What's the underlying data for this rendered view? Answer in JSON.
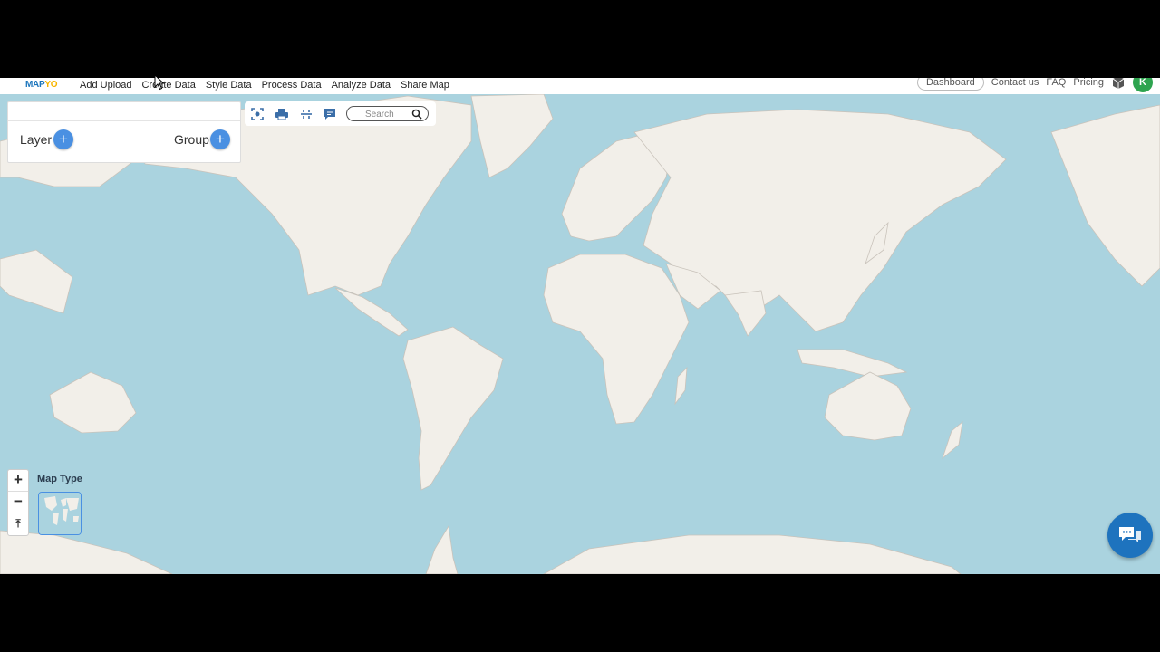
{
  "app": {
    "logo": {
      "text": "MAP",
      "accent": "YO"
    },
    "nav": [
      {
        "label": "Add Upload"
      },
      {
        "label": "Create Data"
      },
      {
        "label": "Style Data"
      },
      {
        "label": "Process Data"
      },
      {
        "label": "Analyze Data"
      },
      {
        "label": "Share Map"
      }
    ],
    "nav_right": {
      "dashboard": "Dashboard",
      "contact": "Contact us",
      "faq": "FAQ",
      "pricing": "Pricing",
      "avatar_initial": "K"
    }
  },
  "layer_panel": {
    "layer_label": "Layer",
    "group_label": "Group",
    "add_symbol": "+"
  },
  "toolbar": {
    "search_placeholder": "Search",
    "tools": [
      "focus-icon",
      "print-icon",
      "measure-icon",
      "comment-icon"
    ]
  },
  "map_controls": {
    "zoom_in": "+",
    "zoom_out": "−",
    "reset_north": "⤒",
    "map_type_label": "Map Type"
  },
  "colors": {
    "water": "#aad3df",
    "land": "#f2efe9",
    "accent": "#4a90e2",
    "chat": "#1e73be",
    "avatar": "#2ea44f"
  }
}
